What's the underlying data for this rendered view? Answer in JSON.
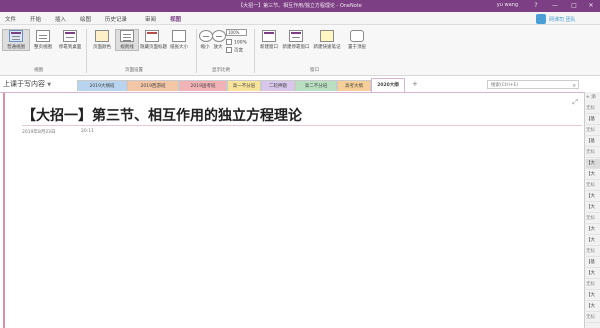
{
  "window": {
    "title": "【大招一】第三节、相互作用/独立方程理论 - OneNote",
    "user": "yu wang",
    "controls": [
      "?",
      "—",
      "□",
      "✕"
    ]
  },
  "ribbon_tabs": [
    "文件",
    "开始",
    "插入",
    "绘图",
    "历史记录",
    "审阅",
    "视图"
  ],
  "active_tab": "视图",
  "brand": {
    "logo_text": "网课司 团队"
  },
  "ribbon": {
    "buttons": {
      "normal_view": "普通视图",
      "full_page_view": "整页视图",
      "dock_to_desktop": "停靠到桌面",
      "page_color": "页面颜色",
      "rule_lines": "规则线",
      "hide_page_title": "隐藏页面标题",
      "paper_size": "纸张大小",
      "zoom_out": "缩小",
      "zoom_in": "放大",
      "new_window": "新建窗口",
      "new_docked_window": "新建停靠窗口",
      "new_quick_note": "新建快速笔记",
      "keep_on_top": "置于顶层"
    },
    "zoom": {
      "value": "100%",
      "option_100": "100%",
      "option_width": "页宽"
    },
    "groups": {
      "views": "视图",
      "page_setup": "页面设置",
      "zoom": "显示比例",
      "window": "窗口"
    }
  },
  "sections": {
    "notebook": "上课于写内容",
    "tabs": [
      {
        "label": "2019大纲班",
        "color": "#b9d4ef"
      },
      {
        "label": "2019西游班",
        "color": "#f3c6a6"
      },
      {
        "label": "2019国考班",
        "color": "#f2b3b8"
      },
      {
        "label": "高一不分层",
        "color": "#f7e39a"
      },
      {
        "label": "二轮押题",
        "color": "#d8c7eb"
      },
      {
        "label": "高二不分班",
        "color": "#b9dfc3"
      },
      {
        "label": "高考大纲",
        "color": "#f6cf98"
      },
      {
        "label": "2020大纲",
        "color": "#ffffff"
      }
    ],
    "active": "2020大纲",
    "add_label": "+",
    "search_placeholder": "搜索(Ctrl+E)",
    "search_icon": "search-icon"
  },
  "page": {
    "title": "【大招一】第三节、相互作用的独立方程理论",
    "date": "2019年8月23日",
    "time": "20:11",
    "expand_icon": "expand-icon"
  },
  "pages_pane": {
    "add_label": "+ 添",
    "entries": [
      {
        "label": "无标",
        "kind": "sub"
      },
      {
        "label": "【基",
        "kind": "page"
      },
      {
        "label": "无标",
        "kind": "sub"
      },
      {
        "label": "【基",
        "kind": "page"
      },
      {
        "label": "无标",
        "kind": "sub"
      },
      {
        "label": "【大",
        "kind": "current"
      },
      {
        "label": "【大",
        "kind": "page"
      },
      {
        "label": "无标",
        "kind": "sub"
      },
      {
        "label": "【大",
        "kind": "page"
      },
      {
        "label": "【大",
        "kind": "page"
      },
      {
        "label": "无标",
        "kind": "sub"
      },
      {
        "label": "【大",
        "kind": "page"
      },
      {
        "label": "【大",
        "kind": "page"
      },
      {
        "label": "无标",
        "kind": "sub"
      },
      {
        "label": "【基",
        "kind": "page"
      },
      {
        "label": "【大",
        "kind": "page"
      },
      {
        "label": "无标",
        "kind": "sub"
      },
      {
        "label": "【大",
        "kind": "page"
      },
      {
        "label": "【大",
        "kind": "page"
      },
      {
        "label": "无标",
        "kind": "sub"
      }
    ]
  },
  "colors": {
    "onenote_purple": "#7c3f83",
    "page_margin_line": "#d88fa3"
  }
}
